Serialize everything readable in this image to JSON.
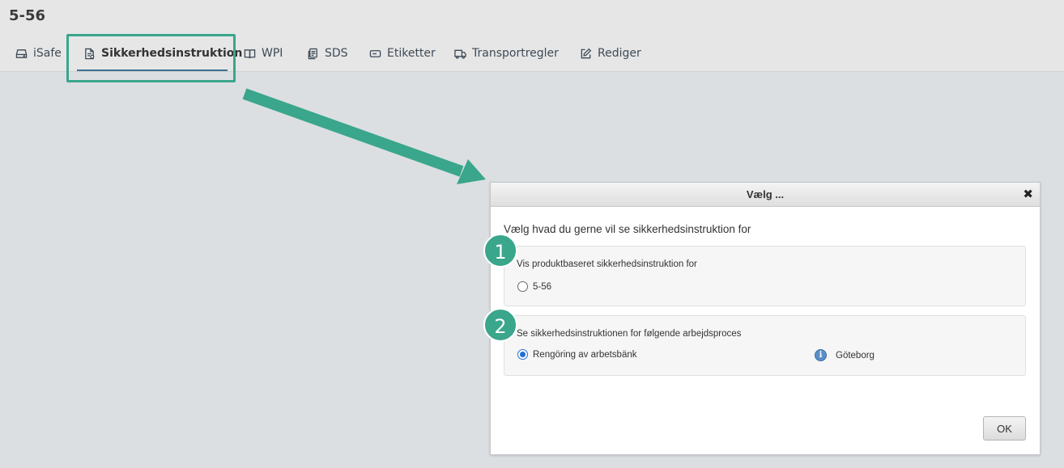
{
  "page": {
    "title": "5-56"
  },
  "tabs": [
    {
      "label": "iSafe",
      "icon": "drive-icon"
    },
    {
      "label": "Sikkerhedsinstruktion",
      "icon": "document-icon",
      "active": true
    },
    {
      "label": "WPI",
      "icon": "book-icon"
    },
    {
      "label": "SDS",
      "icon": "files-icon"
    },
    {
      "label": "Etiketter",
      "icon": "label-icon"
    },
    {
      "label": "Transportregler",
      "icon": "truck-icon"
    },
    {
      "label": "Rediger",
      "icon": "edit-icon"
    }
  ],
  "dialog": {
    "title": "Vælg ...",
    "close": "✖",
    "prompt": "Vælg hvad du gerne vil se sikkerhedsinstruktion for",
    "section1": {
      "badge": "1",
      "label": "Vis produktbaseret sikkerhedsinstruktion for",
      "option": {
        "label": "5-56",
        "selected": false
      }
    },
    "section2": {
      "badge": "2",
      "label": "Se sikkerhedsinstruktionen for følgende arbejdsproces",
      "option": {
        "label": "Rengöring av arbetsbänk",
        "selected": true
      },
      "location": "Göteborg",
      "info_icon": "i"
    },
    "ok_label": "OK"
  },
  "colors": {
    "accent": "#3aa68c",
    "tab_underline": "#3f6e8f",
    "radio_selected": "#1f6fd6",
    "background": "#dcdfe2"
  }
}
